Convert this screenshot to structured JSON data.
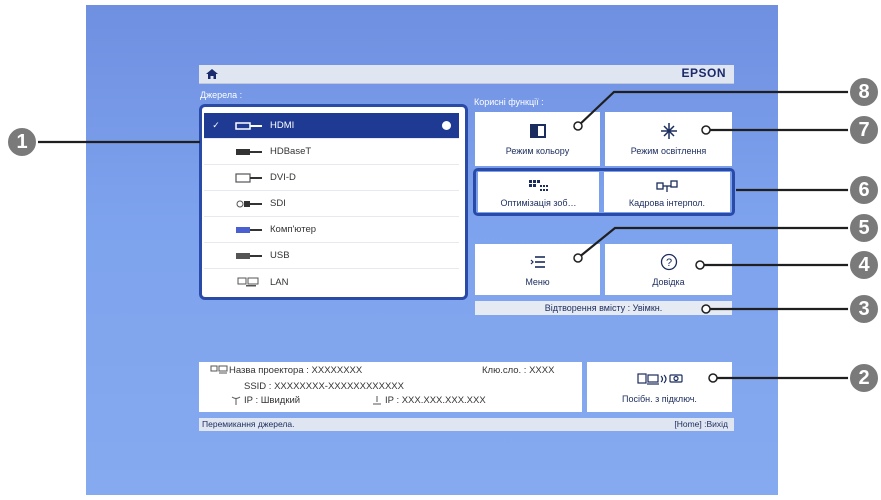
{
  "brand": "EPSON",
  "sources": {
    "label": "Джерела :",
    "items": [
      {
        "label": "HDMI",
        "selected": true
      },
      {
        "label": "HDBaseT"
      },
      {
        "label": "DVI-D"
      },
      {
        "label": "SDI"
      },
      {
        "label": "Комп'ютер"
      },
      {
        "label": "USB"
      },
      {
        "label": "LAN"
      }
    ],
    "check": "✓"
  },
  "functions": {
    "label": "Корисні функції :",
    "color_mode": "Режим кольору",
    "light_mode": "Режим освітлення",
    "optimize": "Оптимізація зоб…",
    "frame_interp": "Кадрова інтерпол.",
    "menu": "Меню",
    "help": "Довідка",
    "content_playback": "Відтворення вмісту : Увімкн.",
    "connection_guide": "Посібн. з підключ."
  },
  "info": {
    "projector_name": "Назва проектора  :  XXXXXXXX",
    "key": "Клю.сло. : XXXX",
    "ssid": "SSID  :  XXXXXXXX-XXXXXXXXXXXX",
    "ip_mode": "IP  :  Швидкий",
    "ip": "IP  :   XXX.XXX.XXX.XXX"
  },
  "footer": {
    "left": "Перемикання джерела.",
    "right": "[Home] :Вихід"
  },
  "callouts": [
    "1",
    "2",
    "3",
    "4",
    "5",
    "6",
    "7",
    "8"
  ]
}
